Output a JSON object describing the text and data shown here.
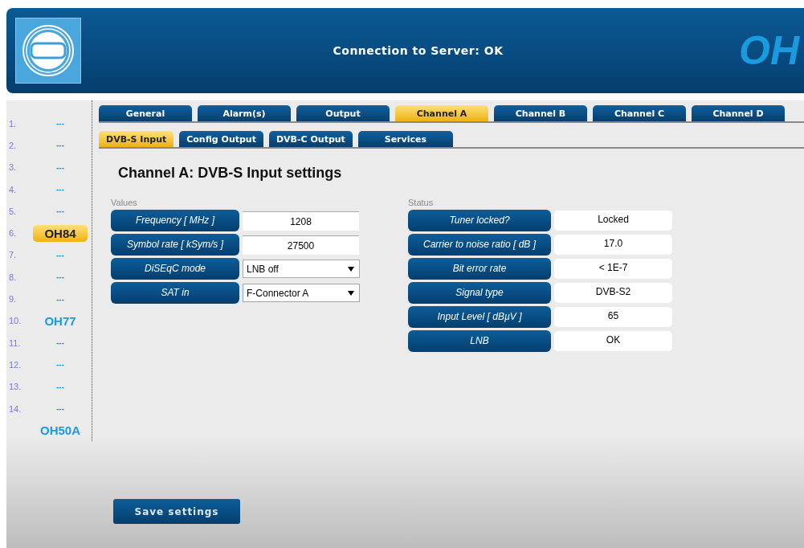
{
  "header": {
    "connection": "Connection to Server: OK",
    "device": "OH"
  },
  "sidebar": {
    "items": [
      {
        "number": "1.",
        "name": "---",
        "selected": false
      },
      {
        "number": "2.",
        "name": "---",
        "selected": false
      },
      {
        "number": "3.",
        "name": "---",
        "selected": false
      },
      {
        "number": "4.",
        "name": "---",
        "selected": false
      },
      {
        "number": "5.",
        "name": "---",
        "selected": false
      },
      {
        "number": "6.",
        "name": "OH84",
        "selected": true
      },
      {
        "number": "7.",
        "name": "---",
        "selected": false
      },
      {
        "number": "8.",
        "name": "---",
        "selected": false
      },
      {
        "number": "9.",
        "name": "---",
        "selected": false
      },
      {
        "number": "10.",
        "name": "OH77",
        "selected": false
      },
      {
        "number": "11.",
        "name": "---",
        "selected": false
      },
      {
        "number": "12.",
        "name": "---",
        "selected": false
      },
      {
        "number": "13.",
        "name": "---",
        "selected": false
      },
      {
        "number": "14.",
        "name": "---",
        "selected": false
      },
      {
        "name": "OH50A",
        "selected": false
      }
    ]
  },
  "tabs": [
    {
      "label": "General",
      "selected": false
    },
    {
      "label": "Alarm(s)",
      "selected": false
    },
    {
      "label": "Output",
      "selected": false
    },
    {
      "label": "Channel A",
      "selected": true
    },
    {
      "label": "Channel B",
      "selected": false
    },
    {
      "label": "Channel C",
      "selected": false
    },
    {
      "label": "Channel D",
      "selected": false
    }
  ],
  "subtabs": [
    {
      "label": "DVB-S Input",
      "selected": true
    },
    {
      "label": "Config Output",
      "selected": false
    },
    {
      "label": "DVB-C Output",
      "selected": false
    },
    {
      "label": "Services",
      "selected": false
    }
  ],
  "heading": "Channel A: DVB-S Input settings",
  "values": {
    "title": "Values",
    "rows": [
      {
        "kind": "input",
        "label": "Frequency [ MHz ]",
        "value": "1208"
      },
      {
        "kind": "input",
        "label": "Symbol rate [ kSym/s ]",
        "value": "27500"
      },
      {
        "kind": "select",
        "label": "DiSEqC mode",
        "value": "LNB off"
      },
      {
        "kind": "select",
        "label": "SAT in",
        "value": "F-Connector A"
      }
    ]
  },
  "status": {
    "title": "Status",
    "rows": [
      {
        "label": "Tuner locked?",
        "value": "Locked"
      },
      {
        "label": "Carrier to noise ratio [ dB ]",
        "value": "17.0"
      },
      {
        "label": "Bit error rate",
        "value": "< 1E-7"
      },
      {
        "label": "Signal type",
        "value": "DVB-S2"
      },
      {
        "label": "Input Level [ dBµV ]",
        "value": "65"
      },
      {
        "label": "LNB",
        "value": "OK"
      }
    ]
  },
  "save_button": "Save settings"
}
